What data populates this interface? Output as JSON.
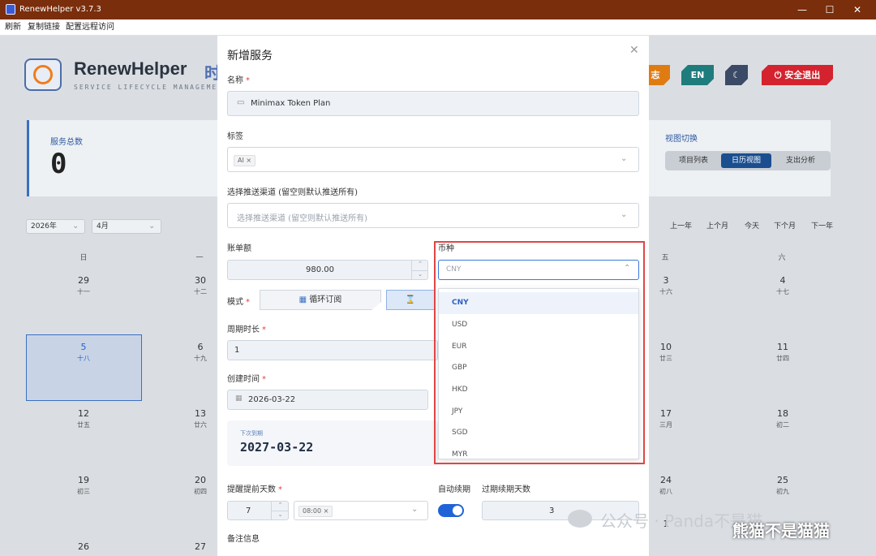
{
  "window": {
    "title": "RenewHelper v3.7.3"
  },
  "menu": [
    "刷新",
    "复制链接",
    "配置远程访问"
  ],
  "app": {
    "brand": "RenewHelper",
    "brand_cn": "时",
    "brand_sub": "SERVICE LIFECYCLE MANAGEMENT",
    "header_buttons": {
      "log": "志",
      "lang": "EN",
      "logout": "安全退出"
    },
    "stats": {
      "total_label": "服务总数",
      "total_value": "0"
    },
    "view_switch": {
      "label": "视图切换",
      "options": [
        "项目列表",
        "日历视图",
        "支出分析"
      ],
      "active": "日历视图"
    },
    "calendar": {
      "year_select": "2026年",
      "month_select": "4月",
      "nav": [
        "上一年",
        "上个月",
        "今天",
        "下个月",
        "下一年"
      ],
      "dow": [
        "日",
        "一",
        "五",
        "六"
      ],
      "cells": [
        {
          "day": "29",
          "lunar": "十一"
        },
        {
          "day": "30",
          "lunar": "十二"
        },
        {
          "day": "3",
          "lunar": "十六"
        },
        {
          "day": "4",
          "lunar": "十七"
        },
        {
          "day": "5",
          "lunar": "十八"
        },
        {
          "day": "6",
          "lunar": "十九"
        },
        {
          "day": "10",
          "lunar": "廿三"
        },
        {
          "day": "11",
          "lunar": "廿四"
        },
        {
          "day": "12",
          "lunar": "廿五"
        },
        {
          "day": "13",
          "lunar": "廿六"
        },
        {
          "day": "17",
          "lunar": "三月"
        },
        {
          "day": "18",
          "lunar": "初二"
        },
        {
          "day": "19",
          "lunar": "初三"
        },
        {
          "day": "20",
          "lunar": "初四"
        },
        {
          "day": "24",
          "lunar": "初八"
        },
        {
          "day": "25",
          "lunar": "初九"
        },
        {
          "day": "26",
          "lunar": ""
        },
        {
          "day": "27",
          "lunar": ""
        },
        {
          "day": "1",
          "lunar": ""
        }
      ]
    }
  },
  "modal": {
    "title": "新增服务",
    "name_label": "名称",
    "name_value": "Minimax Token Plan",
    "tags_label": "标签",
    "tag": "AI",
    "channel_label": "选择推送渠道 (留空则默认推送所有)",
    "channel_placeholder": "选择推送渠道 (留空则默认推送所有)",
    "amount_label": "账单额",
    "amount_value": "980.00",
    "currency_label": "币种",
    "currency_value": "CNY",
    "currency_options": [
      "CNY",
      "USD",
      "EUR",
      "GBP",
      "HKD",
      "JPY",
      "SGD",
      "MYR"
    ],
    "mode_label": "模式",
    "mode_cycle": "循环订阅",
    "period_label": "周期时长",
    "period_value": "1",
    "created_label": "创建时间",
    "created_value": "2026-03-22",
    "next_due_label": "下次到期",
    "next_due_value": "2027-03-22",
    "remind_label": "提醒提前天数",
    "remind_value": "7",
    "remind_time_tag": "08:00",
    "auto_renew_label": "自动续期",
    "auto_renew_on": true,
    "overdue_label": "过期续期天数",
    "overdue_value": "3",
    "notes_label": "备注信息"
  },
  "watermark": {
    "text": "公众号 · Panda不是猫",
    "name": "熊猫不是猫猫"
  },
  "colors": {
    "titlebar": "#7a2e0c",
    "accent": "#1f63d8",
    "highlight": "#e24545",
    "logout": "#d4232f",
    "log": "#e07b12",
    "lang": "#1f7c7c"
  }
}
